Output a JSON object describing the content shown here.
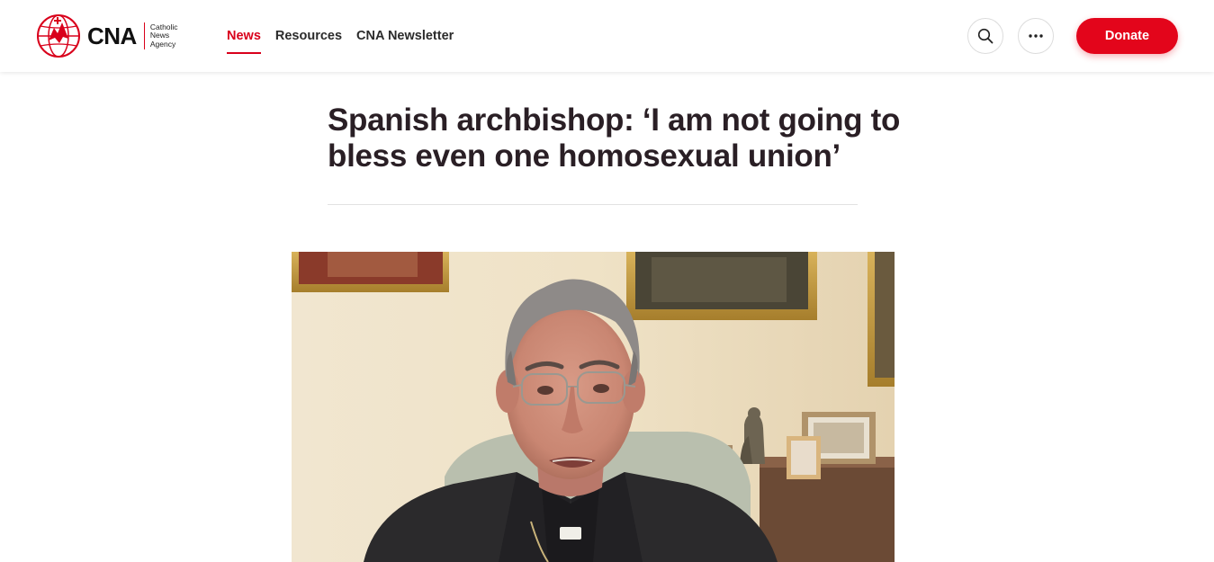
{
  "brand": {
    "name": "CNA",
    "subtitle_lines": [
      "Catholic",
      "News",
      "Agency"
    ],
    "accent_color": "#e3051b"
  },
  "nav": {
    "items": [
      {
        "label": "News",
        "active": true
      },
      {
        "label": "Resources",
        "active": false
      },
      {
        "label": "CNA Newsletter",
        "active": false
      }
    ]
  },
  "header_actions": {
    "search_icon": "search-icon",
    "more_icon": "ellipsis-icon",
    "donate_label": "Donate"
  },
  "article": {
    "headline": "Spanish archbishop: ‘I am not going to bless even one homosexual union’",
    "hero_image": "photo of an archbishop with grey hair and glasses, wearing a dark suit with clerical collar, seated in a room with framed paintings and photos"
  }
}
